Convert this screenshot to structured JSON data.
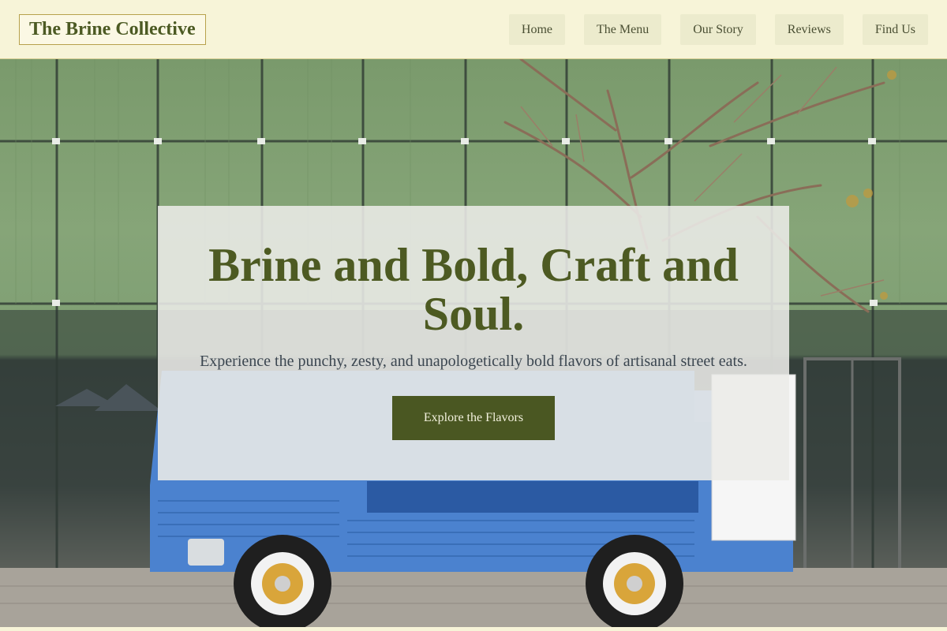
{
  "header": {
    "brand": "The Brine Collective",
    "nav": [
      {
        "label": "Home"
      },
      {
        "label": "The Menu"
      },
      {
        "label": "Our Story"
      },
      {
        "label": "Reviews"
      },
      {
        "label": "Find Us"
      }
    ]
  },
  "hero": {
    "title": "Brine and Bold, Craft and Soul.",
    "subtitle": "Experience the punchy, zesty, and unapologetically bold flavors of artisanal street eats.",
    "cta_label": "Explore the Flavors"
  },
  "colors": {
    "brand_olive": "#4a5722",
    "header_bg": "#f7f4d8",
    "nav_button_bg": "#ecebcd",
    "truck_blue": "#4b82cf"
  }
}
